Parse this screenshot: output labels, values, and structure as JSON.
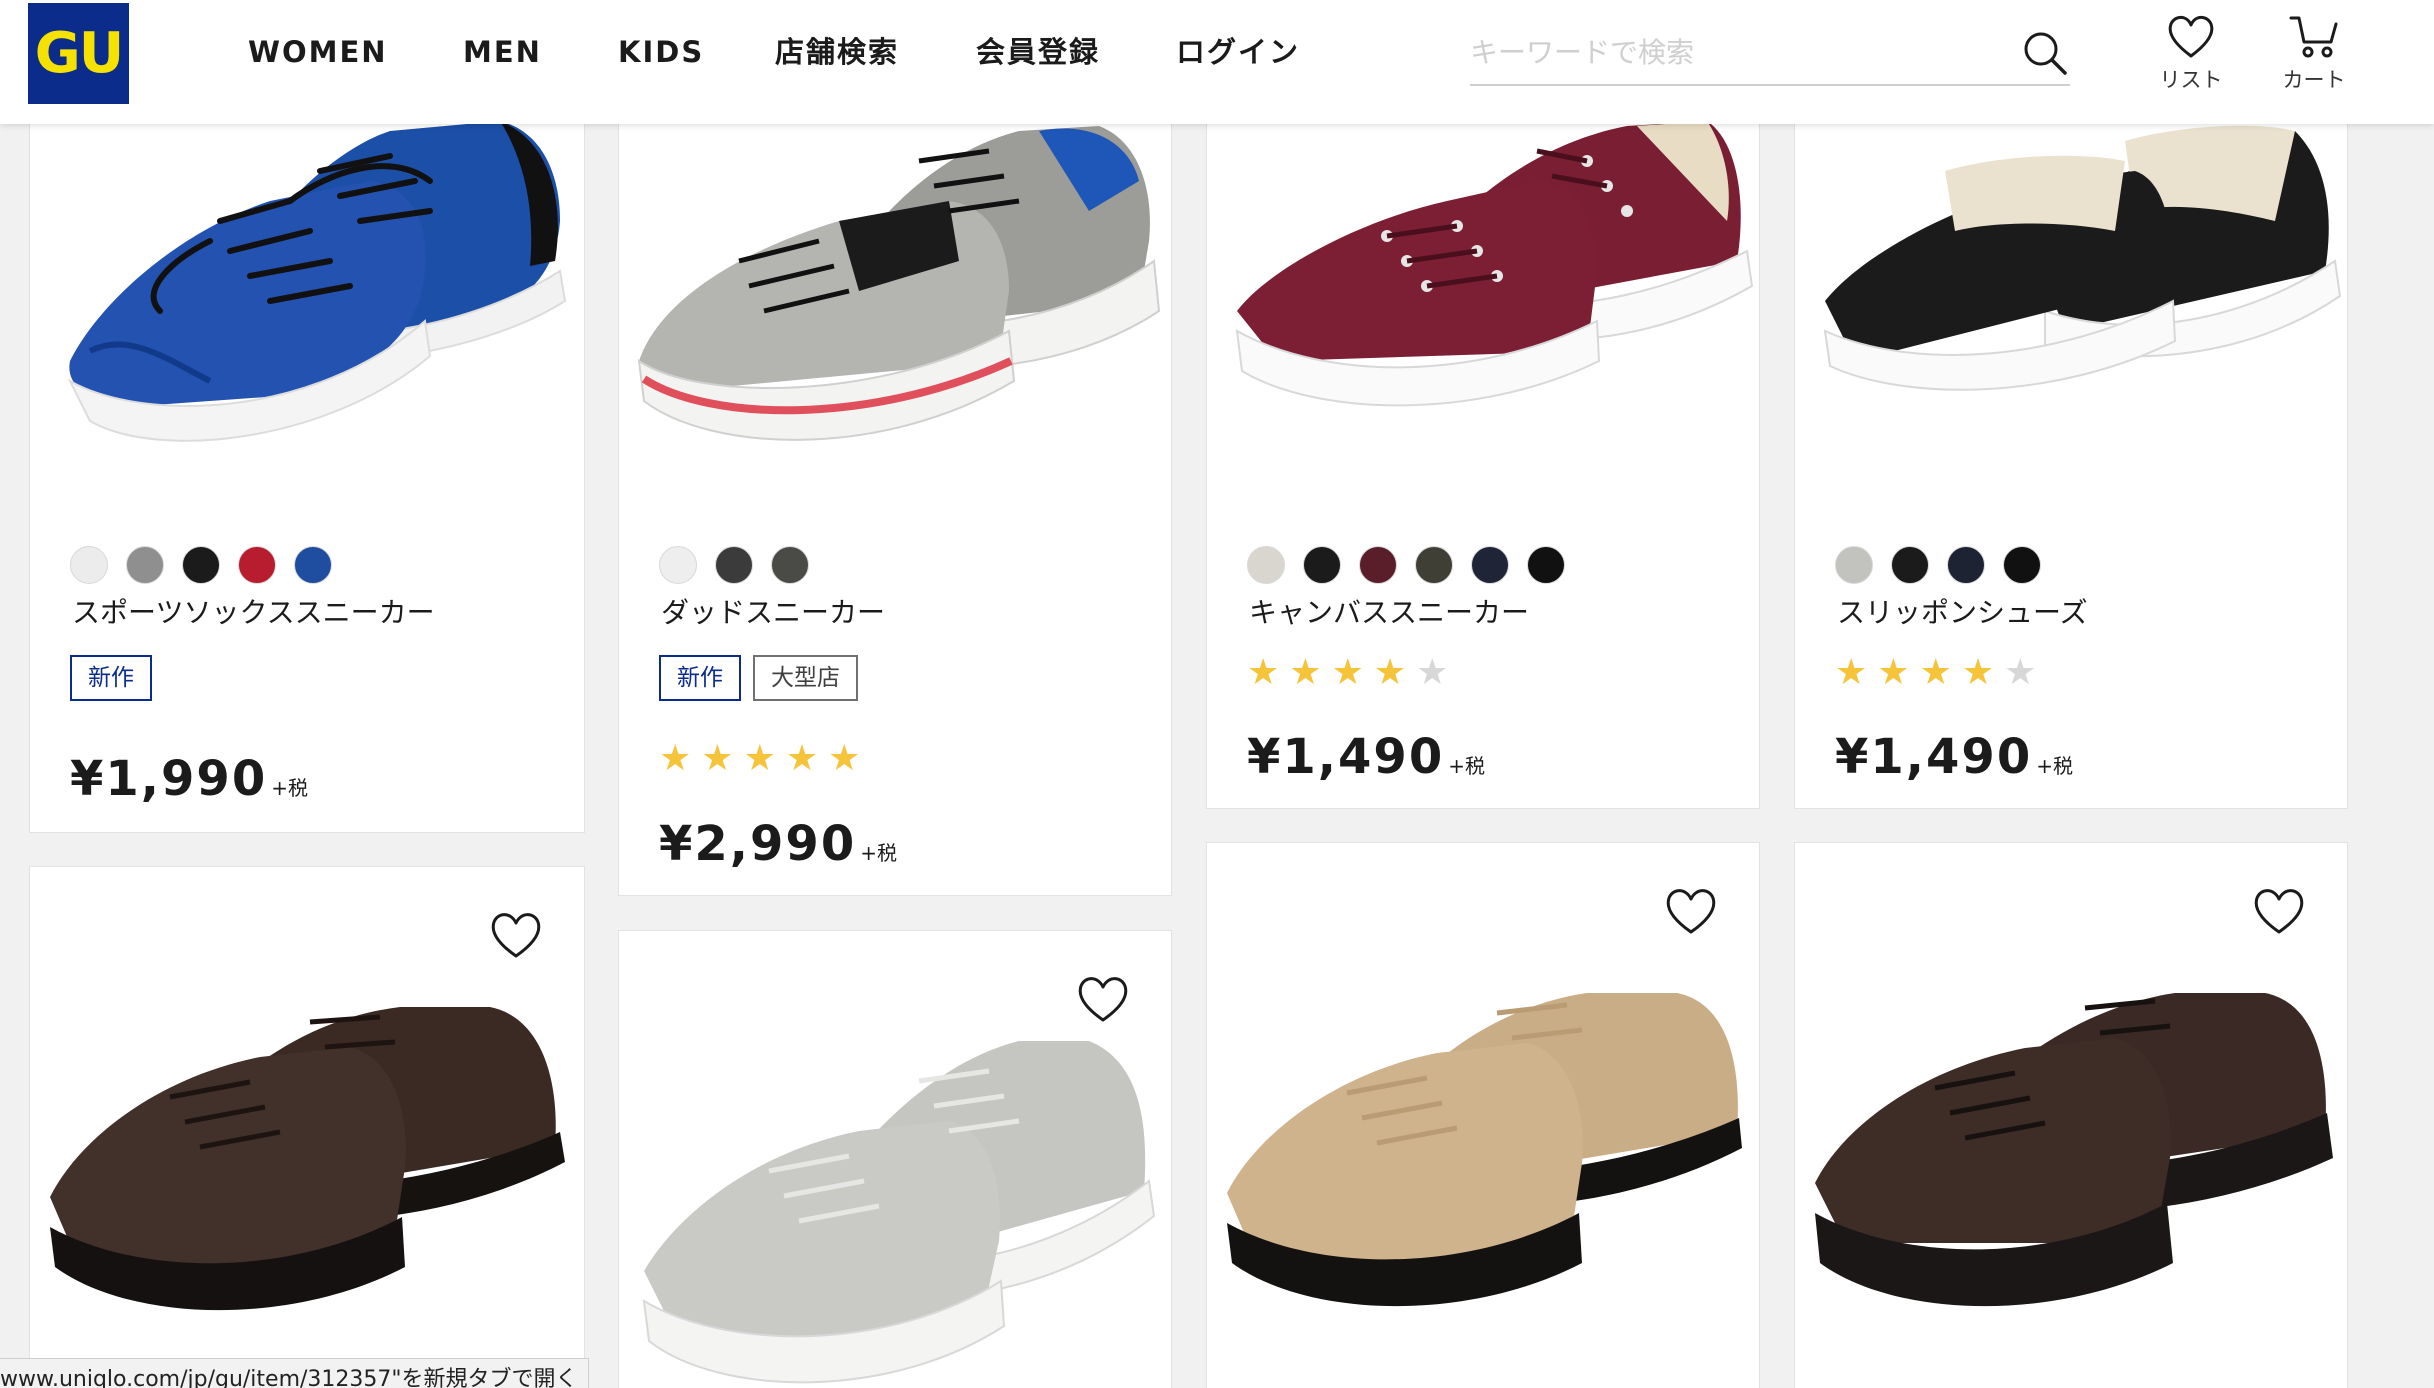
{
  "header": {
    "logo_text": "GU",
    "nav": [
      "WOMEN",
      "MEN",
      "KIDS",
      "店舗検索",
      "会員登録",
      "ログイン"
    ],
    "search_placeholder": "キーワードで検索",
    "list_label": "リスト",
    "cart_label": "カート"
  },
  "products": [
    {
      "name": "スポーツソックススニーカー",
      "swatches": [
        "#ececec",
        "#8f8f8f",
        "#1b1b1b",
        "#b81d2f",
        "#1f4ea0"
      ],
      "badges": [
        {
          "label": "新作",
          "style": "blue"
        }
      ],
      "rating": null,
      "price": "¥1,990",
      "tax": "+税"
    },
    {
      "name": "ダッドスニーカー",
      "swatches": [
        "#eeeeee",
        "#3b3b3b",
        "#4a4a46"
      ],
      "badges": [
        {
          "label": "新作",
          "style": "blue"
        },
        {
          "label": "大型店",
          "style": "grey"
        }
      ],
      "rating": 5,
      "price": "¥2,990",
      "tax": "+税"
    },
    {
      "name": "キャンバススニーカー",
      "swatches": [
        "#d9d6d0",
        "#1b1b1b",
        "#5a1d2a",
        "#3f3f36",
        "#1f2436",
        "#111111"
      ],
      "badges": [],
      "rating": 4,
      "price": "¥1,490",
      "tax": "+税"
    },
    {
      "name": "スリッポンシューズ",
      "swatches": [
        "#c2c2bf",
        "#1b1b1b",
        "#1d2333",
        "#111111"
      ],
      "badges": [],
      "rating": 4,
      "price": "¥1,490",
      "tax": "+税"
    }
  ],
  "status_url": "www.uniqlo.com/jp/gu/item/312357\"を新規タブで開く",
  "colors": {
    "brand_blue": "#0c2c8c",
    "brand_yellow": "#f6e200",
    "star": "#f5c43b"
  }
}
